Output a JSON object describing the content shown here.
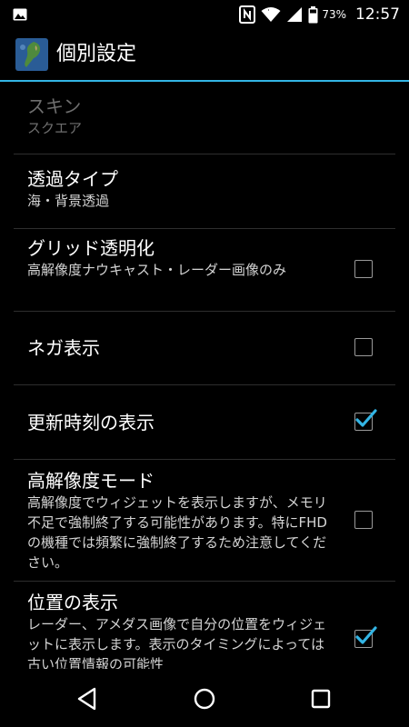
{
  "status": {
    "battery_percent": "73%",
    "time": "12:57"
  },
  "app": {
    "title": "個別設定"
  },
  "settings": [
    {
      "title": "スキン",
      "summary": "スクエア"
    },
    {
      "title": "透過タイプ",
      "summary": "海・背景透過"
    },
    {
      "title": "グリッド透明化",
      "summary": "高解像度ナウキャスト・レーダー画像のみ",
      "checked": false
    },
    {
      "title": "ネガ表示",
      "checked": false
    },
    {
      "title": "更新時刻の表示",
      "checked": true
    },
    {
      "title": "高解像度モード",
      "summary": "高解像度でウィジェットを表示しますが、メモリ不足で強制終了する可能性があります。特にFHDの機種では頻繁に強制終了するため注意してください。",
      "checked": false
    },
    {
      "title": "位置の表示",
      "summary": "レーダー、アメダス画像で自分の位置をウィジェットに表示します。表示のタイミングによっては古い位置情報の可能性",
      "checked": true
    }
  ],
  "colors": {
    "accent": "#33b5e5",
    "check": "#33b5e5",
    "disabled_text": "#6e6e6e"
  }
}
